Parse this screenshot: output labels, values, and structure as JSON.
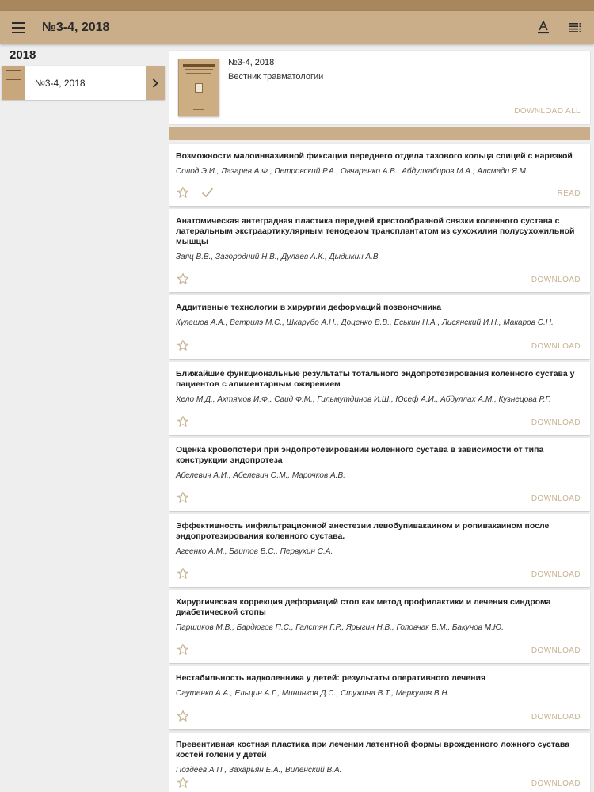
{
  "appbar": {
    "title": "№3-4, 2018",
    "menu_icon": "menu-icon",
    "font_icon": "text-format-icon",
    "list_icon": "toc-icon"
  },
  "sidebar": {
    "year": "2018",
    "issue_label": "№3-4, 2018"
  },
  "issue": {
    "number": "№3-4, 2018",
    "journal": "Вестник травматологии",
    "download_all": "DOWNLOAD ALL"
  },
  "articles": [
    {
      "title": "Возможности малоинвазивной фиксации переднего отдела тазового кольца спицей с нарезкой",
      "authors": "Солод Э.И., Лазарев А.Ф., Петровский Р.А., Овчаренко А.В., Абдулхабиров М.А., Алсмади Я.М.",
      "action": "READ",
      "downloaded": true
    },
    {
      "title": "Анатомическая антеградная пластика передней крестообразной связки коленного сустава с латеральным экстраартикулярным тенодезом трансплантатом из сухожилия полусухожильной мышцы",
      "authors": "Заяц В.В., Загородний Н.В., Дулаев А.К., Дыдыкин А.В.",
      "action": "DOWNLOAD",
      "downloaded": false
    },
    {
      "title": "Аддитивные технологии в хирургии деформаций позвоночника",
      "authors": "Кулешов А.А., Ветрилэ М.С., Шкарубо А.Н., Доценко В.В., Еськин Н.А., Лисянский И.Н., Макаров С.Н.",
      "action": "DOWNLOAD",
      "downloaded": false
    },
    {
      "title": "Ближайшие функциональные результаты тотального эндопротезирования коленного сустава у пациентов с алиментарным ожирением",
      "authors": "Хело М.Д., Ахтямов И.Ф., Саид Ф.М., Гильмутдинов И.Ш., Юсеф А.И., Абдуллах А.М., Кузнецова Р.Г.",
      "action": "DOWNLOAD",
      "downloaded": false
    },
    {
      "title": "Оценка кровопотери при эндопротезировании коленного сустава в зависимости от типа конструкции эндопротеза",
      "authors": "Абелевич А.И., Абелевич О.М., Марочков А.В.",
      "action": "DOWNLOAD",
      "downloaded": false
    },
    {
      "title": "Эффективность инфильтрационной анестезии левобупивакаином и ропивакаином после эндопротезирования коленного сустава.",
      "authors": "Агеенко А.М., Баитов В.С., Первухин С.А.",
      "action": "DOWNLOAD",
      "downloaded": false
    },
    {
      "title": "Хирургическая коррекция деформаций стоп как метод профилактики и лечения синдрома диабетической стопы",
      "authors": "Паршиков М.В., Бардюгов П.С., Галстян Г.Р., Ярыгин Н.В., Головчак В.М., Бакунов М.Ю.",
      "action": "DOWNLOAD",
      "downloaded": false
    },
    {
      "title": "Нестабильность надколенника у детей: результаты оперативного лечения",
      "authors": "Саутенко А.А., Ельцин А.Г., Мининков Д.С., Стужина В.Т., Меркулов В.Н.",
      "action": "DOWNLOAD",
      "downloaded": false
    },
    {
      "title": "Превентивная костная пластика при лечении латентной  формы врожденного ложного сустава костей голени у детей",
      "authors": "Поздеев А.П., Захарьян Е.А., Виленский В.А.",
      "action": "DOWNLOAD",
      "downloaded": false
    }
  ]
}
